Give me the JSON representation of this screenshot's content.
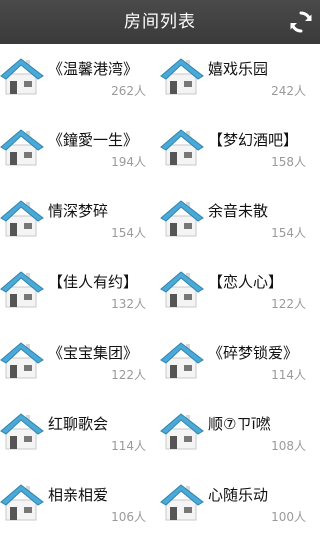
{
  "header": {
    "title": "房间列表",
    "refresh_icon": "refresh-icon"
  },
  "rooms": [
    {
      "name": "《温馨港湾》",
      "count": "262人"
    },
    {
      "name": "嬉戏乐园",
      "count": "242人"
    },
    {
      "name": "《鐘愛一生》",
      "count": "194人"
    },
    {
      "name": "【梦幻酒吧】",
      "count": "158人"
    },
    {
      "name": "情深梦碎",
      "count": "154人"
    },
    {
      "name": "余音未散",
      "count": "154人"
    },
    {
      "name": "【佳人有约】",
      "count": "132人"
    },
    {
      "name": "【恋人心】",
      "count": "122人"
    },
    {
      "name": "《宝宝集团》",
      "count": "122人"
    },
    {
      "name": "《碎梦锁爱》",
      "count": "114人"
    },
    {
      "name": "红聊歌会",
      "count": "114人"
    },
    {
      "name": "顺⑦ㄗī嘫",
      "count": "108人"
    },
    {
      "name": "相亲相爱",
      "count": "106人"
    },
    {
      "name": "心随乐动",
      "count": "100人"
    }
  ],
  "colors": {
    "header_bg": "#3f3f3f",
    "roof": "#4aa9d6",
    "count_text": "#9a9a9a"
  }
}
